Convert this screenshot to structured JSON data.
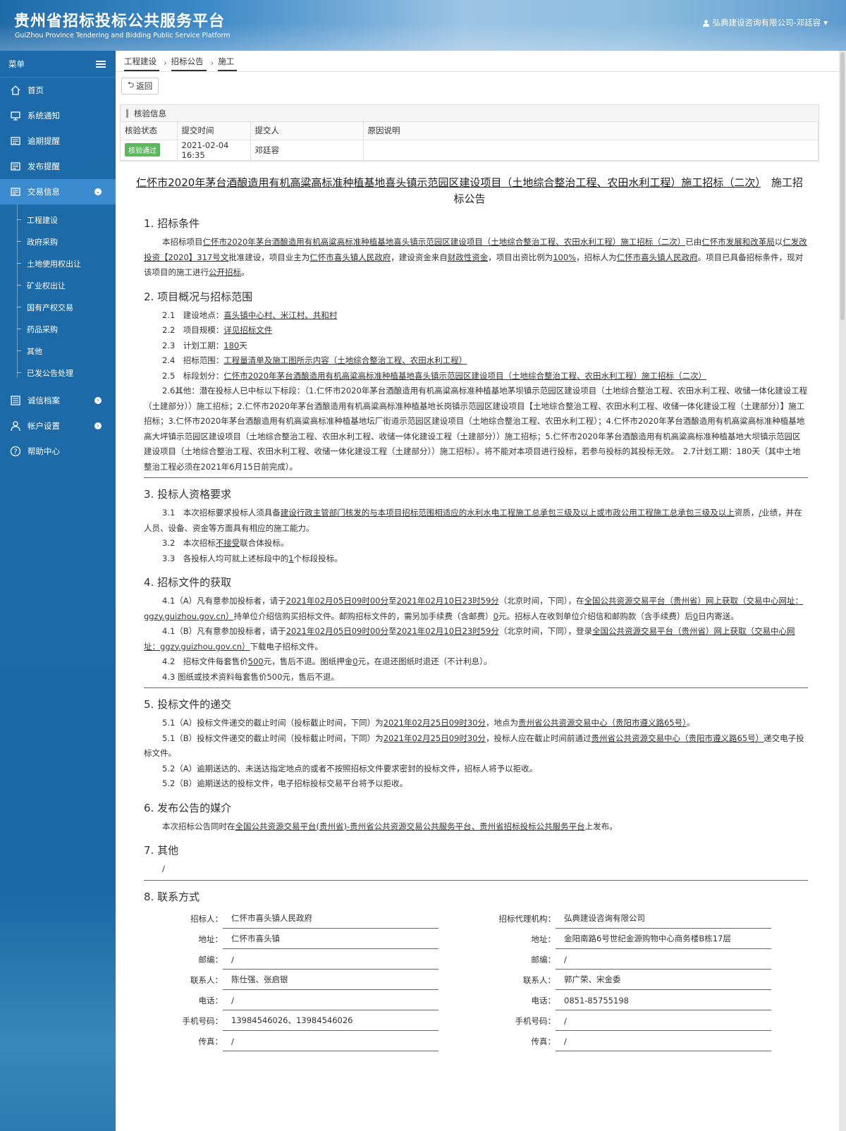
{
  "header": {
    "title": "贵州省招标投标公共服务平台",
    "subtitle": "GuiZhou Province Tendering and Bidding Public Service Platform",
    "user": "弘典建设咨询有限公司-邓廷容"
  },
  "sidebar": {
    "menu_label": "菜单",
    "items": [
      "首页",
      "系统通知",
      "逾期提醒",
      "发布提醒",
      "交易信息"
    ],
    "subitems": [
      "工程建设",
      "政府采购",
      "土地使用权出让",
      "矿业权出让",
      "国有产权交易",
      "药品采购",
      "其他",
      "已发公告处理"
    ],
    "items2": [
      "诚信档案",
      "帐户设置",
      "帮助中心"
    ]
  },
  "breadcrumb": [
    "工程建设",
    "招标公告",
    "施工"
  ],
  "back_label": "返回",
  "verify": {
    "title": "核验信息",
    "headers": [
      "核验状态",
      "提交时间",
      "提交人",
      "原因说明"
    ],
    "status": "核验通过",
    "time": "2021-02-04 16:35",
    "submitter": "邓廷容",
    "reason": ""
  },
  "doc": {
    "title_link": "仁怀市2020年茅台酒酿造用有机高粱高标准种植基地喜头镇示范园区建设项目（土地综合整治工程、农田水利工程）施工招标（二次）",
    "title_tail1": "施工招",
    "title_tail2": "标公告",
    "s1": "1. 招标条件",
    "s1p": [
      "本招标项目",
      "仁怀市2020年茅台酒酿造用有机高粱高标准种植基地喜头镇示范园区建设项目（土地综合整治工程、农田水利工程）施工招标（二次）",
      "已由",
      "仁怀市发展和改革局",
      "以",
      "仁发改投资【2020】317号文",
      "批准建设，项目业主为",
      "仁怀市喜头镇人民政府",
      "，建设资金来自",
      "财政性资金",
      "，项目出资比例为",
      "100%",
      "，招标人为",
      "仁怀市喜头镇人民政府",
      "。项目已具备招标条件，现对该项目的施工进行",
      "公开招标",
      "。"
    ],
    "s2": "2. 项目概况与招标范围",
    "s2p": [
      [
        "2.1　建设地点：",
        "喜头镇中心村、米江村、共和村"
      ],
      [
        "2.2　项目规模：",
        "详见招标文件"
      ],
      [
        "2.3　计划工期：",
        "180",
        "天"
      ],
      [
        "2.4　招标范围：",
        "工程量清单及施工图所示内容（土地综合整治工程、农田水利工程）"
      ],
      [
        "2.5　标段划分：",
        "仁怀市2020年茅台酒酿造用有机高粱高标准种植基地喜头镇示范园区建设项目（土地综合整治工程、农田水利工程）施工招标（二次）"
      ]
    ],
    "s2other": "2.6其他：潜在投标人已中标以下标段：（1.仁怀市2020年茅台酒酿造用有机高粱高标准种植基地茅坝镇示范园区建设项目（土地综合整治工程、农田水利工程、收储一体化建设工程（土建部分））施工招标；2.仁怀市2020年茅台酒酿造用有机高粱高标准种植基地长岗镇示范园区建设项目【土地综合整治工程、农田水利工程、收储一体化建设工程（土建部分）】施工招标；3.仁怀市2020年茅台酒酿造用有机高粱高标准种植基地坛厂街道示范园区建设项目（土地综合整治工程、农田水利工程）；4.仁怀市2020年茅台酒酿造用有机高粱高标准种植基地高大坪镇示范园区建设项目（土地综合整治工程、农田水利工程、收储一体化建设工程（土建部分））施工招标；5.仁怀市2020年茅台酒酿造用有机高粱高标准种植基地大坝镇示范园区建设项目（土地综合整治工程、农田水利工程、收储一体化建设工程（土建部分））施工招标）。将不能对本项目进行投标，若参与投标的其投标无效。　2.7计划工期：180天（其中土地整治工程必须在2021年6月15日前完成）。",
    "s3": "3. 投标人资格要求",
    "s3p1": [
      "3.1　本次招标要求投标人须具备",
      "建设行政主管部门核发的与本项目招标范围相适应的水利水电工程施工总承包三级及以上或市政公用工程施工总承包三级及以上",
      "资质，",
      "/",
      "业绩，并在人员、设备、资金等方面具有相应的施工能力。"
    ],
    "s3p2": [
      "3.2　本次招标",
      "不接受",
      "联合体投标。"
    ],
    "s3p3": [
      "3.3　各投标人均可就上述标段中的",
      "1",
      "个标段投标。"
    ],
    "s4": "4. 招标文件的获取",
    "s4p1": [
      "4.1（A）凡有意参加投标者，请于",
      "2021年02月05日09时00分",
      "至",
      "2021年02月10日23时59分",
      "（北京时间，下同），在",
      "全国公共资源交易平台（贵州省）网上获取（交易中心网址：ggzy.guizhou.gov.cn）",
      "持单位介绍信购买招标文件。邮购招标文件的，需另加手续费（含邮费）",
      "0",
      "元。招标人在收到单位介绍信和邮购款（含手续费）后",
      "0",
      "日内寄送。"
    ],
    "s4p2": [
      "4.1（B）凡有意参加投标者，请于",
      "2021年02月05日09时00分",
      "至",
      "2021年02月10日23时59分",
      "（北京时间，下同），登录",
      "全国公共资源交易平台（贵州省）网上获取（交易中心网址：ggzy.guizhou.gov.cn）",
      "下载电子招标文件。"
    ],
    "s4p3": [
      "4.2　招标文件每套售价",
      "500",
      "元，售后不退。图纸押金",
      "0",
      "元，在退还图纸时退还（不计利息）。"
    ],
    "s4p4": "4.3 图纸或技术资料每套售价500元，售后不退。",
    "s5": "5. 投标文件的递交",
    "s5p1": [
      "5.1（A）投标文件递交的截止时间（投标截止时间，下同）为",
      "2021年02月25日09时30分",
      "，地点为",
      "贵州省公共资源交易中心（贵阳市遵义路65号）",
      "。"
    ],
    "s5p2": [
      "5.1（B）投标文件递交的截止时间（投标截止时间，下同）为",
      "2021年02月25日09时30分",
      "，投标人应在截止时间前通过",
      "贵州省公共资源交易中心（贵阳市遵义路65号）",
      "递交电子投标文件。"
    ],
    "s5p3": "5.2（A）逾期送达的、未送达指定地点的或者不按照招标文件要求密封的投标文件，招标人将予以拒收。",
    "s5p4": "5.2（B）逾期送达的投标文件，电子招标投标交易平台将予以拒收。",
    "s6": "6. 发布公告的媒介",
    "s6p": [
      "本次招标公告同时在",
      "全国公共资源交易平台(贵州省)-贵州省公共资源交易公共服务平台、贵州省招标投标公共服务平台",
      "上发布。"
    ],
    "s7": "7. 其他",
    "s7p": "/",
    "s8": "8. 联系方式",
    "contact_left": [
      [
        "招标人：",
        "仁怀市喜头镇人民政府"
      ],
      [
        "地址：",
        "仁怀市喜头镇"
      ],
      [
        "邮编：",
        "/"
      ],
      [
        "联系人：",
        "陈仕强、张启银"
      ],
      [
        "电话：",
        "/"
      ],
      [
        "手机号码：",
        "13984546026、13984546026"
      ],
      [
        "传真：",
        "/"
      ]
    ],
    "contact_right": [
      [
        "招标代理机构：",
        "弘典建设咨询有限公司"
      ],
      [
        "地址：",
        "金阳南路6号世纪金源购物中心商务楼B栋17层"
      ],
      [
        "邮编：",
        "/"
      ],
      [
        "联系人：",
        "郭广荣、宋金委"
      ],
      [
        "电话：",
        "0851-85755198"
      ],
      [
        "手机号码：",
        "/"
      ],
      [
        "传真：",
        "/"
      ]
    ]
  }
}
